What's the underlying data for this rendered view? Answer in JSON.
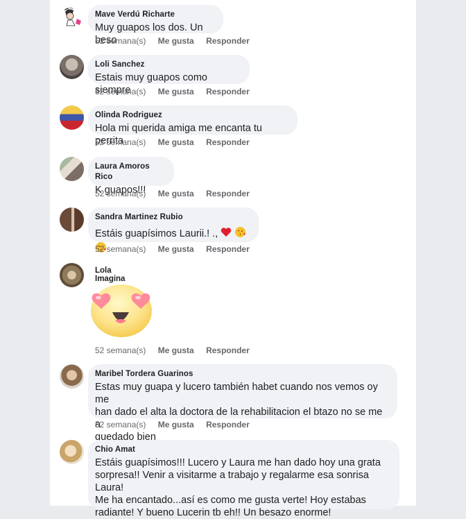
{
  "comments": [
    {
      "author": "Mave Verdú Richarte",
      "text": "Muy guapos los dos. Un beso",
      "time": "52 semana(s)",
      "like": "Me gusta",
      "reply": "Responder"
    },
    {
      "author": "Loli Sanchez",
      "text": "Estais muy guapos como siempre",
      "time": "52 semana(s)",
      "like": "Me gusta",
      "reply": "Responder"
    },
    {
      "author": "Olinda Rodriguez",
      "text": "Hola mi querida amiga me encanta tu perrita",
      "time": "52 semana(s)",
      "like": "Me gusta",
      "reply": "Responder"
    },
    {
      "author": "Laura Amoros Rico",
      "text": "K guapos!!!",
      "time": "52 semana(s)",
      "like": "Me gusta",
      "reply": "Responder"
    },
    {
      "author": "Sandra Martinez Rubio",
      "text": "Estáis guapísimos Laurii.! .,",
      "time": "52 semana(s)",
      "like": "Me gusta",
      "reply": "Responder"
    },
    {
      "author": "Lola Imagina",
      "text": "",
      "time": "52 semana(s)",
      "like": "Me gusta",
      "reply": "Responder"
    },
    {
      "author": "Maribel Tordera Guarinos",
      "lines": [
        "Estas muy guapa y lucero también  habet cuando nos vemos oy me",
        "han dado el alta la doctora de la rehabilitacion  el btazo no se me a",
        "quedado bien"
      ],
      "time": "52 semana(s)",
      "like": "Me gusta",
      "reply": "Responder"
    },
    {
      "author": "Chio Amat",
      "lines": [
        "Estáis guapísimos!!! Lucero y Laura me han dado hoy una grata",
        "sorpresa!! Venir a visitarme a trabajo y regalarme esa sonrisa Laura!",
        "Me ha encantado...así es como me gusta verte! Hoy estabas",
        "radiante! Y bueno Lucerin tb eh!! Un besazo enorme!"
      ]
    }
  ],
  "colors": {
    "bubble": "#f0f2f5",
    "meta": "#65676b",
    "text": "#1c1e21",
    "page_bg": "#e9ebee"
  },
  "icons": [
    "heart-emoji-icon",
    "kiss-emoji-icon",
    "heart-eyes-sticker-icon"
  ]
}
